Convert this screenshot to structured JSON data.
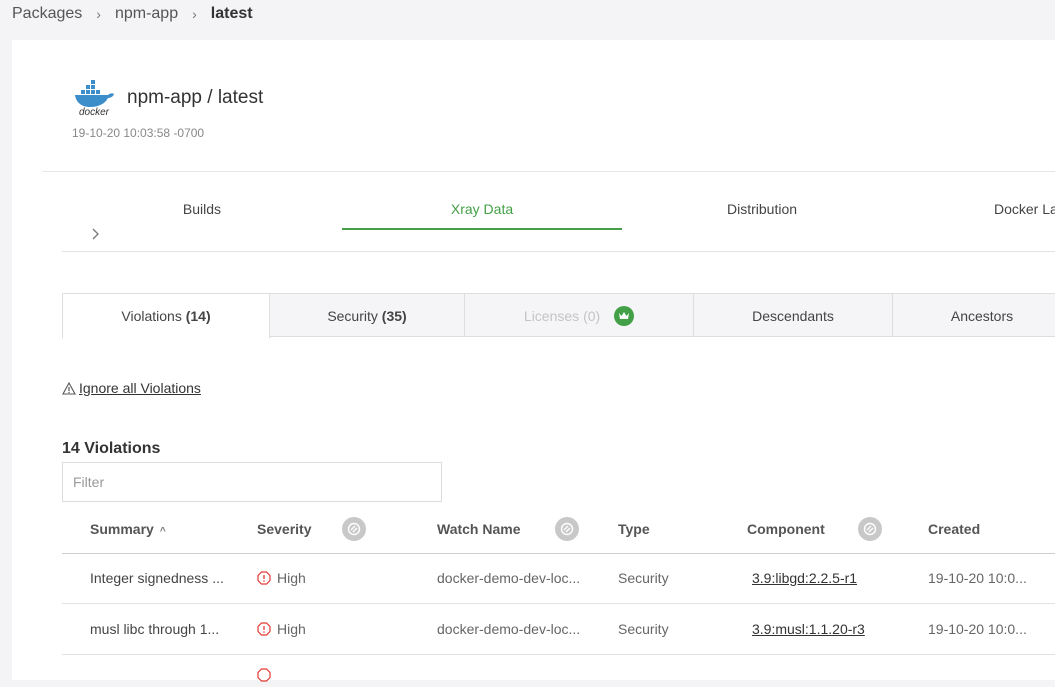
{
  "breadcrumb": {
    "items": [
      "Packages",
      "npm-app"
    ],
    "current": "latest",
    "separator": "›"
  },
  "header": {
    "logo_text": "docker",
    "title": "npm-app / latest",
    "date": "19-10-20 10:03:58 -0700"
  },
  "main_tabs": [
    {
      "label": "Builds"
    },
    {
      "label": "Xray Data"
    },
    {
      "label": "Distribution"
    },
    {
      "label": "Docker La"
    }
  ],
  "active_main_tab": "Xray Data",
  "sub_tabs": [
    {
      "label": "Violations",
      "count": "(14)"
    },
    {
      "label": "Security",
      "count": "(35)"
    },
    {
      "label": "Licenses",
      "count": "(0)"
    },
    {
      "label": "Descendants",
      "count": ""
    },
    {
      "label": "Ancestors",
      "count": ""
    }
  ],
  "ignore_all_label": "Ignore all Violations",
  "violations_title": "14 Violations",
  "filter": {
    "placeholder": "Filter",
    "value": ""
  },
  "columns": [
    "Summary",
    "Severity",
    "Watch Name",
    "Type",
    "Component",
    "Created"
  ],
  "rows": [
    {
      "summary": "Integer signedness ...",
      "severity": "High",
      "watch": "docker-demo-dev-loc...",
      "type": "Security",
      "component": "3.9:libgd:2.2.5-r1",
      "created": "19-10-20 10:0..."
    },
    {
      "summary": "musl libc through 1...",
      "severity": "High",
      "watch": "docker-demo-dev-loc...",
      "type": "Security",
      "component": "3.9:musl:1.1.20-r3",
      "created": "19-10-20 10:0..."
    }
  ],
  "colors": {
    "accent": "#43a047",
    "high_severity": "#e53935"
  }
}
